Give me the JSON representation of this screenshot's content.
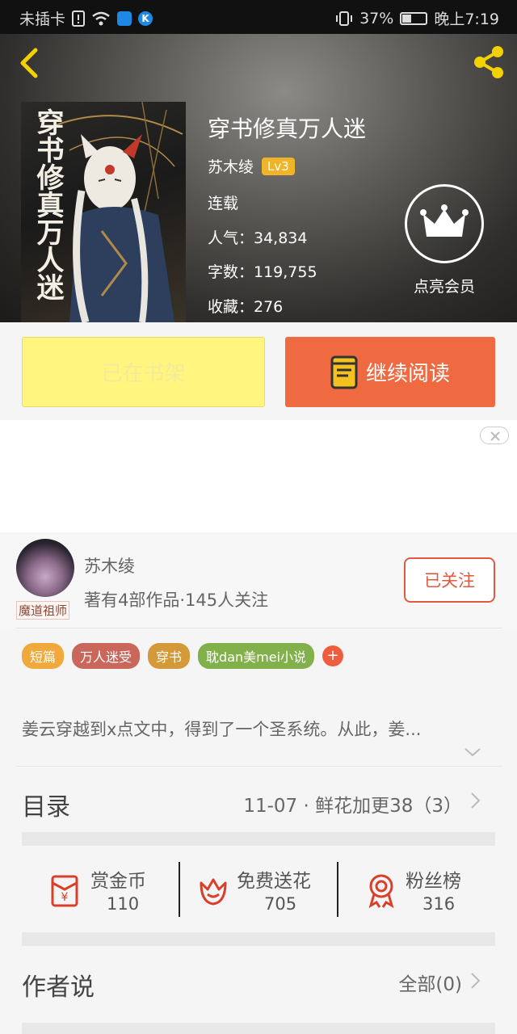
{
  "status_bar": {
    "carrier": "未插卡",
    "battery": "37%",
    "battery_level": 0.37,
    "time": "晚上7:19"
  },
  "book": {
    "cover_title": "穿书修真万人迷",
    "title": "穿书修真万人迷",
    "author": "苏木绫",
    "level": "Lv3",
    "status": "连载",
    "popularity": "人气：34,834",
    "word_count": "字数：119,755",
    "favorites": "收藏：276"
  },
  "vip": {
    "label": "点亮会员"
  },
  "actions": {
    "shelf_label": "已在书架",
    "read_label": "继续阅读"
  },
  "author_card": {
    "name": "苏木绫",
    "info": "著有4部作品·145人关注",
    "avatar_tag": "魔道祖师",
    "follow_label": "已关注"
  },
  "tags": [
    {
      "label": "短篇",
      "color": "#f2a93b"
    },
    {
      "label": "万人迷受",
      "color": "#c9675a"
    },
    {
      "label": "穿书",
      "color": "#d49a3a"
    },
    {
      "label": "耽dan美mei小说",
      "color": "#82b04a"
    }
  ],
  "tag_add": "+",
  "summary": "姜云穿越到x点文中，得到了一个圣系统。从此，姜...",
  "catalog": {
    "title": "目录",
    "latest": "11-07 · 鲜花加更38（3）"
  },
  "rewards": [
    {
      "label": "赏金币",
      "value": "110",
      "icon": "red-envelope-icon"
    },
    {
      "label": "免费送花",
      "value": "705",
      "icon": "flower-icon"
    },
    {
      "label": "粉丝榜",
      "value": "316",
      "icon": "medal-icon"
    }
  ],
  "author_says": {
    "title": "作者说",
    "all": "全部(0)"
  },
  "colors": {
    "accent": "#ef6a40",
    "shelf_button": "#fff57f",
    "level_badge": "#f0b429",
    "follow": "#e05a3f"
  }
}
